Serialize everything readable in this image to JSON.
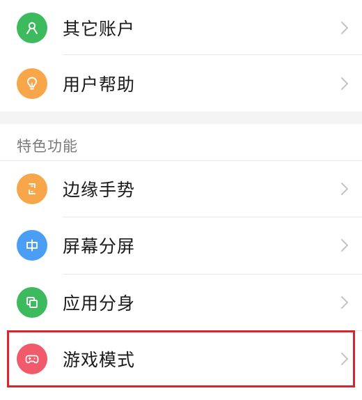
{
  "top_items": [
    {
      "label": "其它账户",
      "icon": "user-icon",
      "color": "#3dba5d"
    },
    {
      "label": "用户帮助",
      "icon": "lightbulb-icon",
      "color": "#f8a64a"
    }
  ],
  "feature_section": {
    "header": "特色功能",
    "items": [
      {
        "label": "边缘手势",
        "icon": "edge-gesture-icon",
        "color": "#f8a64a"
      },
      {
        "label": "屏幕分屏",
        "icon": "split-screen-icon",
        "color": "#4a9ff5"
      },
      {
        "label": "应用分身",
        "icon": "app-clone-icon",
        "color": "#3dba5d"
      },
      {
        "label": "游戏模式",
        "icon": "gamepad-icon",
        "color": "#f05a6a"
      }
    ]
  },
  "highlight_color": "#d9252b",
  "chevron_color": "#c4c4c4"
}
